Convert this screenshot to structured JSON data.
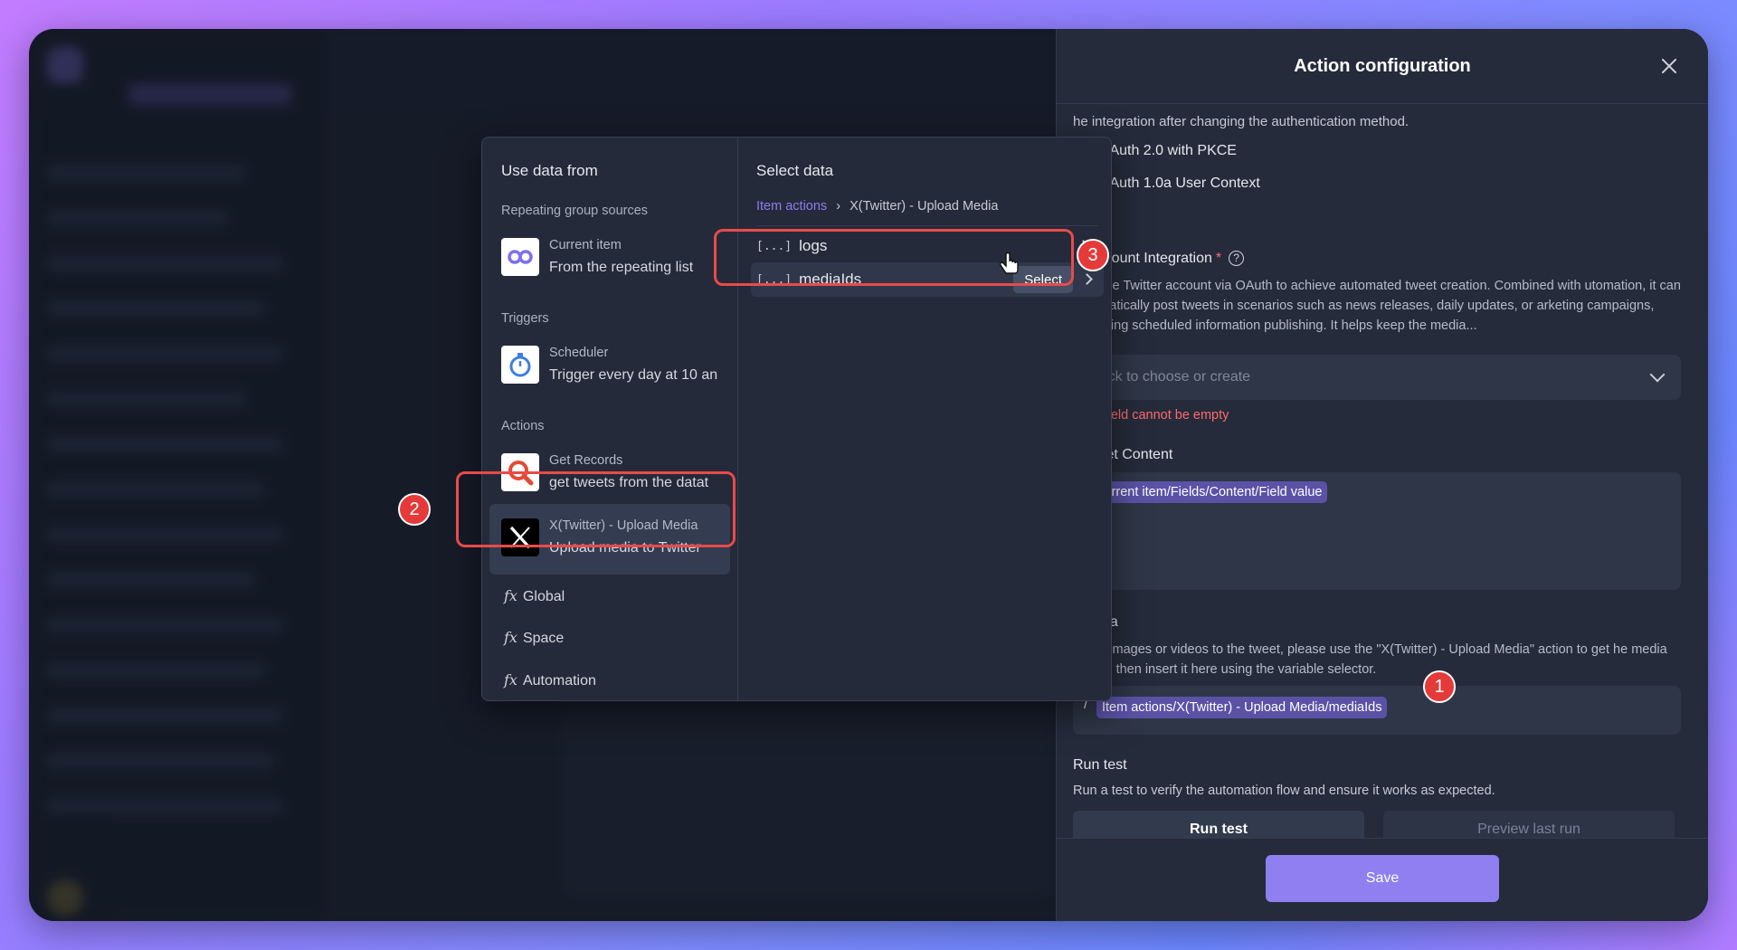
{
  "panel": {
    "title": "Action configuration",
    "intro_text": "he integration after changing the authentication method.",
    "auth_options": [
      "OAuth 2.0 with PKCE",
      "OAuth 1.0a User Context"
    ],
    "account_label": "Account Integration",
    "required_mark": "*",
    "account_desc": "ct to the Twitter account via OAuth to achieve automated tweet creation. Combined with utomation, it can automatically post tweets in scenarios such as news releases, daily updates, or arketing campaigns, achieving scheduled information publishing. It helps keep the media...",
    "account_placeholder": "Click to choose or create",
    "account_error": "his field cannot be empty",
    "tweet_label": "weet Content",
    "tweet_token": "Current item/Fields/Content/Field value",
    "media_label": "ledia",
    "media_desc": "o add images or videos to the tweet, please use the \"X(Twitter) - Upload Media\" action to get he media id, and then insert it here using the variable selector.",
    "media_prefix": "/",
    "media_token": "Item actions/X(Twitter) - Upload Media/mediaIds",
    "run_test_title": "Run test",
    "run_test_desc": "Run a test to verify the automation flow and ensure it works as expected.",
    "run_test_button": "Run test",
    "preview_button": "Preview last run",
    "save_button": "Save"
  },
  "popup": {
    "left_title": "Use data from",
    "groups": {
      "repeating": "Repeating group sources",
      "triggers": "Triggers",
      "actions": "Actions"
    },
    "sources": {
      "current_item": {
        "title": "Current item",
        "sub": "From the repeating list"
      },
      "scheduler": {
        "title": "Scheduler",
        "sub": "Trigger every day at 10 an"
      },
      "get_records": {
        "title": "Get Records",
        "sub": "get tweets from the datat"
      },
      "upload_media": {
        "title": "X(Twitter) - Upload Media",
        "sub": "Upload media to Twitter"
      }
    },
    "fx_items": [
      "Global",
      "Space",
      "Automation"
    ],
    "right_title": "Select data",
    "breadcrumb": {
      "link": "Item actions",
      "sep": "›",
      "current": "X(Twitter) - Upload Media"
    },
    "bracket_glyph": "[...]",
    "data_rows": [
      "logs",
      "mediaIds"
    ],
    "select_label": "Select"
  },
  "annotations": [
    "1",
    "2",
    "3"
  ],
  "colors": {
    "accent": "#8f7ff0",
    "annotation": "#ea4a4a",
    "error": "#ff6a6a"
  }
}
